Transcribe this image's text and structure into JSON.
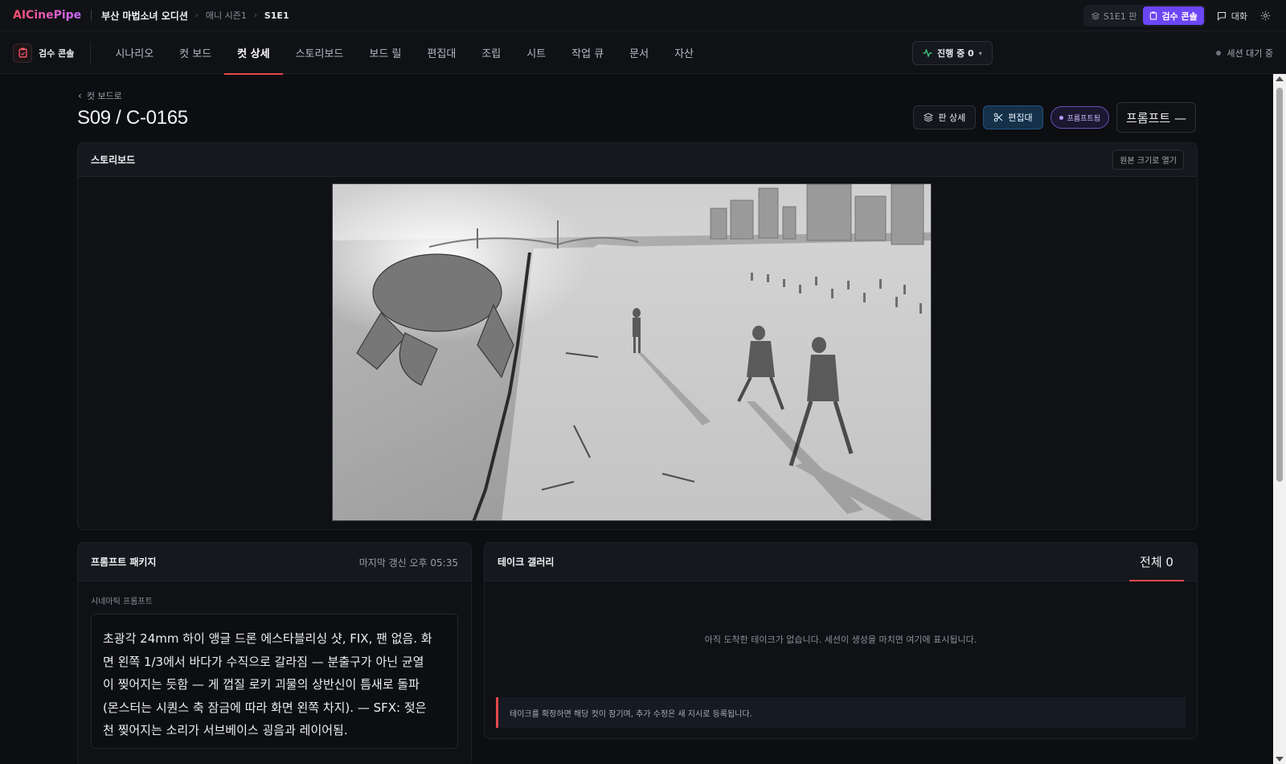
{
  "app": {
    "logo": "AICinePipe",
    "breadcrumb": {
      "project": "부산 마법소녀 오디션",
      "season": "애니 시즌1",
      "episode": "S1E1"
    },
    "top_right": {
      "edition_label": "S1E1 판",
      "review_console_label": "검수 콘솔",
      "chat_label": "대화"
    }
  },
  "nav": {
    "console_label": "검수 콘솔",
    "tabs": [
      {
        "label": "시나리오"
      },
      {
        "label": "컷 보드"
      },
      {
        "label": "컷 상세",
        "active": true
      },
      {
        "label": "스토리보드"
      },
      {
        "label": "보드 릴"
      },
      {
        "label": "편집대"
      },
      {
        "label": "조립"
      },
      {
        "label": "시트"
      },
      {
        "label": "작업 큐"
      },
      {
        "label": "문서"
      },
      {
        "label": "자산"
      }
    ],
    "progress_label": "진행 중 0",
    "session_status": "세션 대기 중"
  },
  "page": {
    "back_label": "컷 보드로",
    "title": "S09 / C-0165",
    "actions": {
      "edition_detail": "판 상세",
      "editor": "편집대",
      "status_pill": "프롬프트됨",
      "prompt_button": "프롬프트 —"
    }
  },
  "storyboard": {
    "title": "스토리보드",
    "open_original": "원본 크기로 열기"
  },
  "prompt_package": {
    "title": "프롬프트 패키지",
    "last_updated": "마지막 갱신 오후 05:35",
    "section_label": "시네마틱 프롬프트",
    "lines": [
      "초광각 24mm 하이 앵글 드론 에스타블리싱 샷, FIX, 팬 없음. 화",
      "면 왼쪽 1/3에서 바다가 수직으로 갈라짐 — 분출구가 아닌 균열",
      "이 찢어지는 듯함 — 게 껍질 로키 괴물의 상반신이 틈새로 돌파",
      "(몬스터는 시퀀스 축 잠금에 따라 화면 왼쪽 차지). — SFX: 젖은",
      "천 찢어지는 소리가 서브베이스 굉음과 레이어됨."
    ]
  },
  "take_gallery": {
    "title": "테이크 갤러리",
    "count_label": "전체 0",
    "empty_message": "아직 도착한 테이크가 없습니다. 세션이 생성을 마치면 여기에 표시됩니다.",
    "notice": "테이크를 확정하면 해당 컷이 잠기며, 추가 수정은 새 지시로 등록됩니다."
  },
  "colors": {
    "accent_red": "#e5484d",
    "accent_purple": "#6b46f5",
    "editor_blue": "#15314a",
    "background": "#0c0e12"
  }
}
